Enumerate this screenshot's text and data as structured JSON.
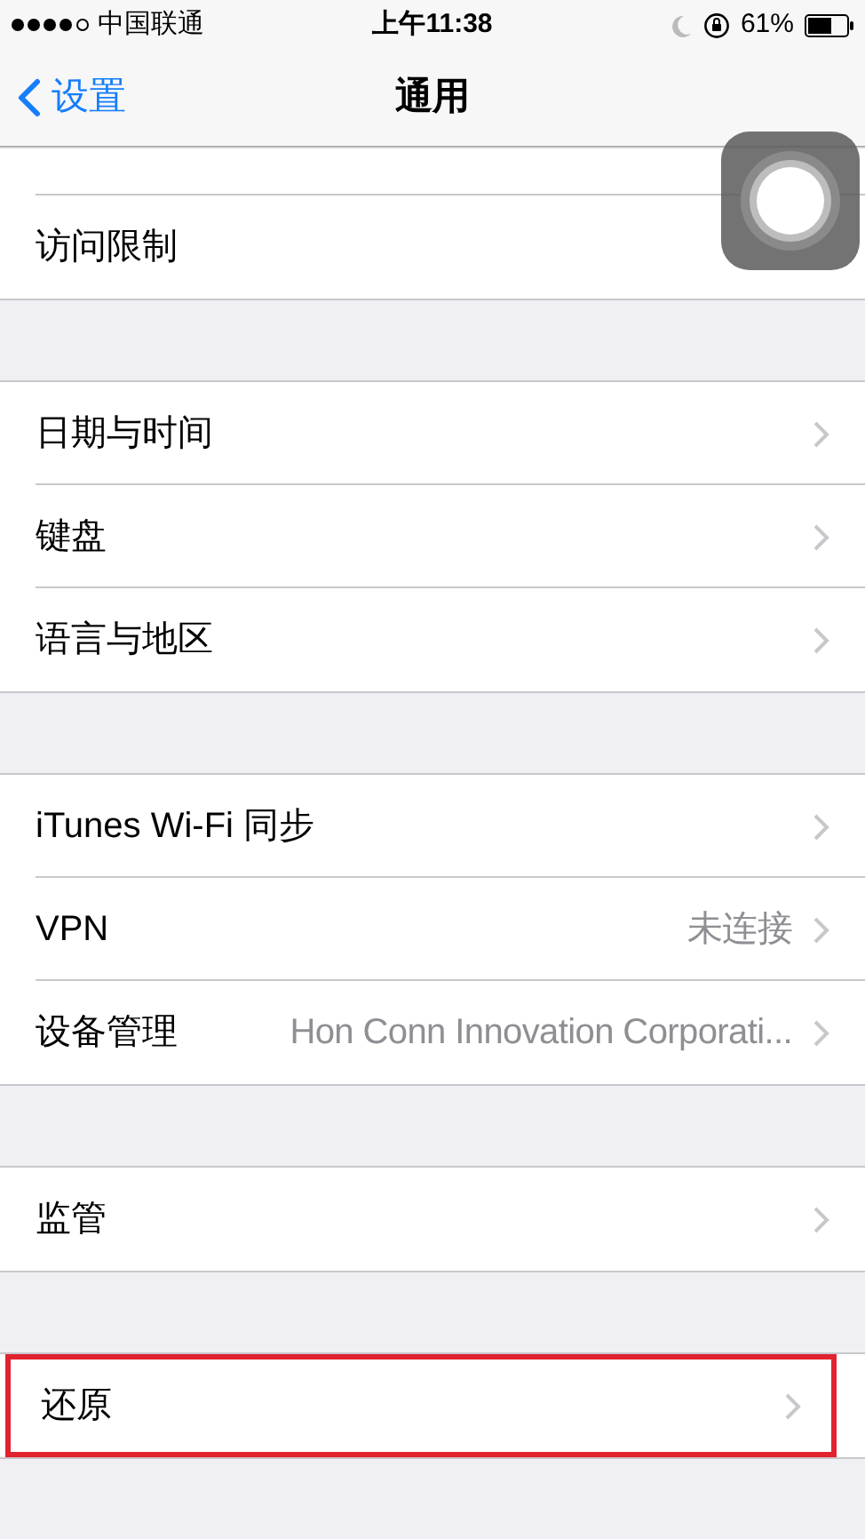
{
  "status_bar": {
    "carrier": "中国联通",
    "time": "上午11:38",
    "battery": "61%"
  },
  "nav": {
    "back": "设置",
    "title": "通用"
  },
  "groups": [
    {
      "cut_off_above": true,
      "rows": [
        {
          "label": "访问限制",
          "annotated": false
        }
      ]
    },
    {
      "cut_off_above": false,
      "rows": [
        {
          "label": "日期与时间",
          "chevron": true,
          "annotated": false
        },
        {
          "label": "键盘",
          "chevron": true,
          "annotated": false
        },
        {
          "label": "语言与地区",
          "chevron": true,
          "annotated": false
        }
      ]
    },
    {
      "cut_off_above": false,
      "rows": [
        {
          "label": "iTunes Wi-Fi 同步",
          "chevron": true,
          "annotated": false
        },
        {
          "label": "VPN",
          "value": "未连接",
          "chevron": true,
          "annotated": false
        },
        {
          "label": "设备管理",
          "value": "Hon Conn Innovation Corporati...",
          "chevron": true,
          "annotated": false
        }
      ]
    },
    {
      "cut_off_above": false,
      "rows": [
        {
          "label": "监管",
          "chevron": true,
          "annotated": false
        }
      ]
    },
    {
      "cut_off_above": false,
      "rows": [
        {
          "label": "还原",
          "chevron": true,
          "annotated": true
        }
      ]
    }
  ]
}
